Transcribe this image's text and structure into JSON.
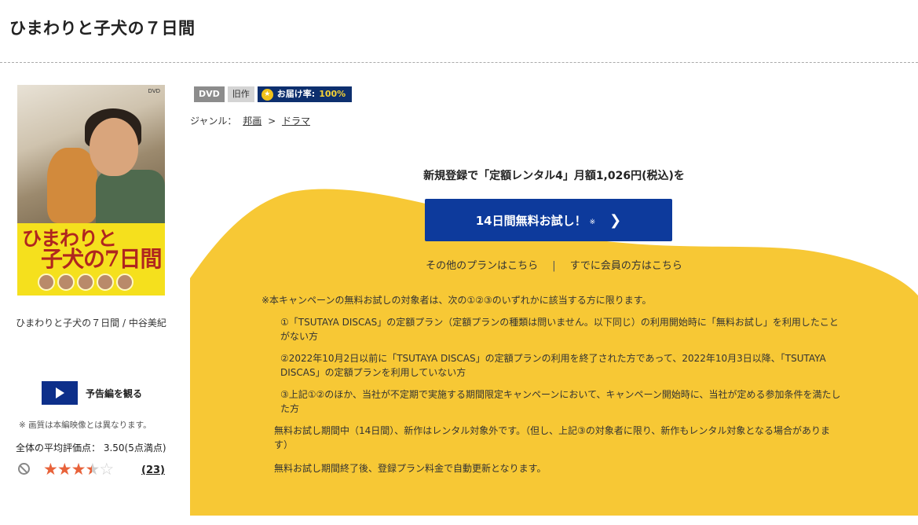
{
  "page": {
    "title": "ひまわりと子犬の７日間"
  },
  "poster": {
    "title_line1": "ひまわりと",
    "title_line2": "子犬の7日間",
    "corner_mark": "DVD"
  },
  "product": {
    "caption": "ひまわりと子犬の７日間 / 中谷美紀",
    "trailer_label": "予告編を観る",
    "quality_note": "※ 画質は本編映像とは異なります。",
    "average_rating_text": "全体の平均評価点： 3.50(5点満点)",
    "rating": 3.5,
    "rating_max": 5,
    "review_count": "(23)"
  },
  "badges": {
    "format": "DVD",
    "category": "旧作",
    "delivery_label": "お届け率:",
    "delivery_rate": "100%"
  },
  "genre": {
    "label": "ジャンル：",
    "items": [
      "邦画",
      "ドラマ"
    ],
    "separator": ">"
  },
  "campaign": {
    "headline": "新規登録で「定額レンタル4」月額1,026円(税込)を",
    "cta_label": "14日間無料お試し！",
    "cta_mark": "※",
    "other_plans_link": "その他のプランはこちら",
    "link_separator": "|",
    "member_link": "すでに会員の方はこちら",
    "terms_head": "※本キャンペーンの無料お試しの対象者は、次の①②③のいずれかに該当する方に限ります。",
    "terms": [
      "①「TSUTAYA DISCAS」の定額プラン（定額プランの種類は問いません。以下同じ）の利用開始時に「無料お試し」を利用したことがない方",
      "②2022年10月2日以前に「TSUTAYA DISCAS」の定額プランの利用を終了された方であって、2022年10月3日以降、「TSUTAYA DISCAS」の定額プランを利用していない方",
      "③上記①②のほか、当社が不定期で実施する期間限定キャンペーンにおいて、キャンペーン開始時に、当社が定める参加条件を満たした方"
    ],
    "note_new_releases": "無料お試し期間中（14日間）、新作はレンタル対象外です。（但し、上記③の対象者に限り、新作もレンタル対象となる場合があります）",
    "note_renewal": "無料お試し期間終了後、登録プラン料金で自動更新となります。"
  },
  "colors": {
    "brand_blue": "#0d3a9c",
    "campaign_yellow": "#f7c835",
    "star": "#e8623a"
  }
}
